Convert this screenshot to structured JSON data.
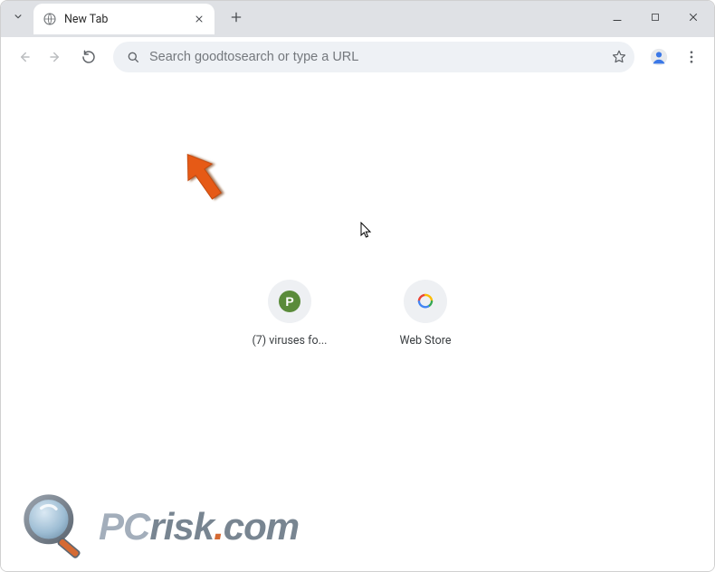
{
  "window": {
    "tab_title": "New Tab"
  },
  "toolbar": {
    "omnibox_placeholder": "Search goodtosearch or type a URL"
  },
  "shortcuts": [
    {
      "label": "(7) viruses fo...",
      "letter": "P",
      "circle_bg": "#eef0f3",
      "badge_bg": "#5a8b3a"
    },
    {
      "label": "Web Store",
      "letter": "",
      "circle_bg": "#eef0f3",
      "badge_bg": ""
    }
  ],
  "watermark": {
    "pc": "PC",
    "risk": "risk",
    "dot": ".",
    "com": "com"
  }
}
